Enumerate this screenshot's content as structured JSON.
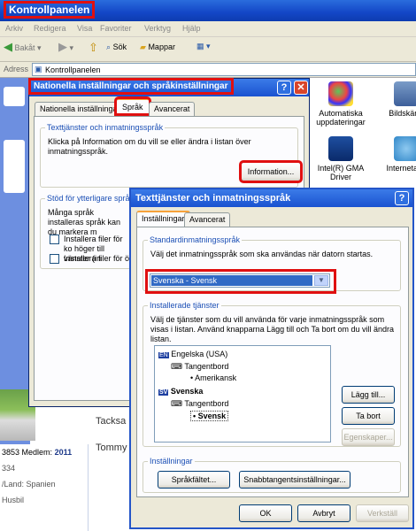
{
  "explorer": {
    "title": "Kontrollpanelen",
    "menu": [
      "Arkiv",
      "Redigera",
      "Visa",
      "Favoriter",
      "Verktyg",
      "Hjälp"
    ],
    "toolbar": {
      "back": "Bakåt",
      "search": "Sök",
      "folders": "Mappar"
    },
    "address_label": "Adress",
    "address_value": "Kontrollpanelen"
  },
  "cp_icons": [
    {
      "label": "Automatiska uppdateringar",
      "icon": "windows-update-icon"
    },
    {
      "label": "Bildskärm",
      "icon": "display-icon"
    },
    {
      "label": "Intel(R) GMA Driver",
      "icon": "intel-gma-icon"
    },
    {
      "label": "Internetalte",
      "icon": "internet-options-icon"
    }
  ],
  "forum": {
    "name_left": "Tacksa",
    "name_left2": "Tommy",
    "line1_prefix": "3853",
    "member_label": "Medlem:",
    "member_year": "2011",
    "line2": "334",
    "line3": "/Land: Spanien",
    "line4": "Husbil"
  },
  "regional_dialog": {
    "title": "Nationella inställningar och språkinställningar",
    "tabs": [
      "Nationella inställninga",
      "Språk",
      "Avancerat"
    ],
    "group1_label": "Texttjänster och inmatningsspråk",
    "group1_text": "Klicka på Information om du vill se eller ändra i listan över inmatningsspråk.",
    "info_button": "Information...",
    "group2_label": "Stöd för ytterligare språk",
    "group2_text": "Många språk installeras språk kan du markera m",
    "check1": "Installera filer för ko höger till vänster (in",
    "check2": "Installera filer för öst"
  },
  "text_services_dialog": {
    "title": "Texttjänster och inmatningsspråk",
    "tabs": [
      "Inställningar",
      "Avancerat"
    ],
    "default_label": "Standardinmatningsspråk",
    "default_text": "Välj det inmatningsspråk som ska användas när datorn startas.",
    "default_value": "Svenska - Svensk",
    "installed_label": "Installerade tjänster",
    "installed_text": "Välj de tjänster som du vill använda för varje inmatningsspråk som visas i listan. Använd knapparna Lägg till och Ta bort om du vill ändra listan.",
    "tree": {
      "en_badge": "EN",
      "en_lang": "Engelska (USA)",
      "en_kb": "Tangentbord",
      "en_layout": "Amerikansk",
      "sv_badge": "SV",
      "sv_lang": "Svenska",
      "sv_kb": "Tangentbord",
      "sv_layout": "Svensk"
    },
    "add_button": "Lägg till...",
    "remove_button": "Ta bort",
    "props_button": "Egenskaper...",
    "prefs_label": "Inställningar",
    "langbar_button": "Språkfältet...",
    "keys_button": "Snabbtangentsinställningar...",
    "ok_button": "OK",
    "cancel_button": "Avbryt",
    "apply_button": "Verkställ"
  }
}
